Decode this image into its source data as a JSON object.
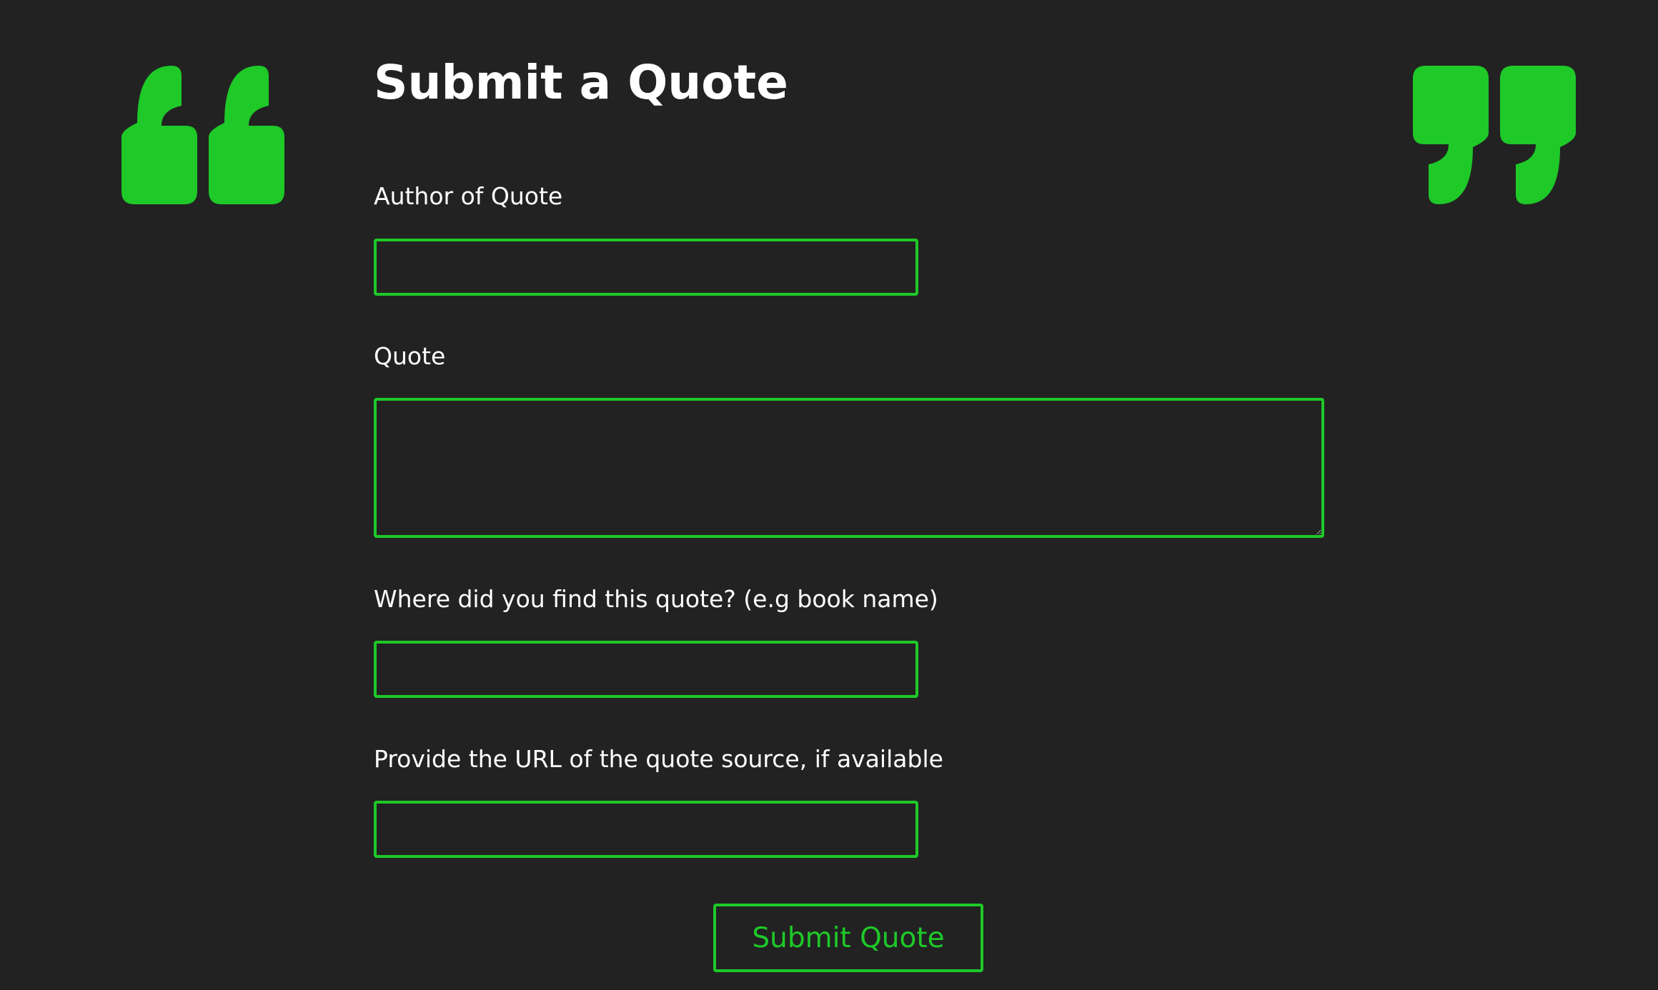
{
  "colors": {
    "background": "#222222",
    "accent": "#1ec928",
    "text": "#ffffff"
  },
  "decorations": {
    "left_icon": "open-quote-mark-icon",
    "right_icon": "close-quote-mark-icon"
  },
  "form": {
    "title": "Submit a Quote",
    "author": {
      "label": "Author of Quote",
      "value": ""
    },
    "quote": {
      "label": "Quote",
      "value": ""
    },
    "source": {
      "label": "Where did you find this quote? (e.g book name)",
      "value": ""
    },
    "url": {
      "label": "Provide the URL of the quote source, if available",
      "value": ""
    },
    "submit_label": "Submit Quote"
  }
}
